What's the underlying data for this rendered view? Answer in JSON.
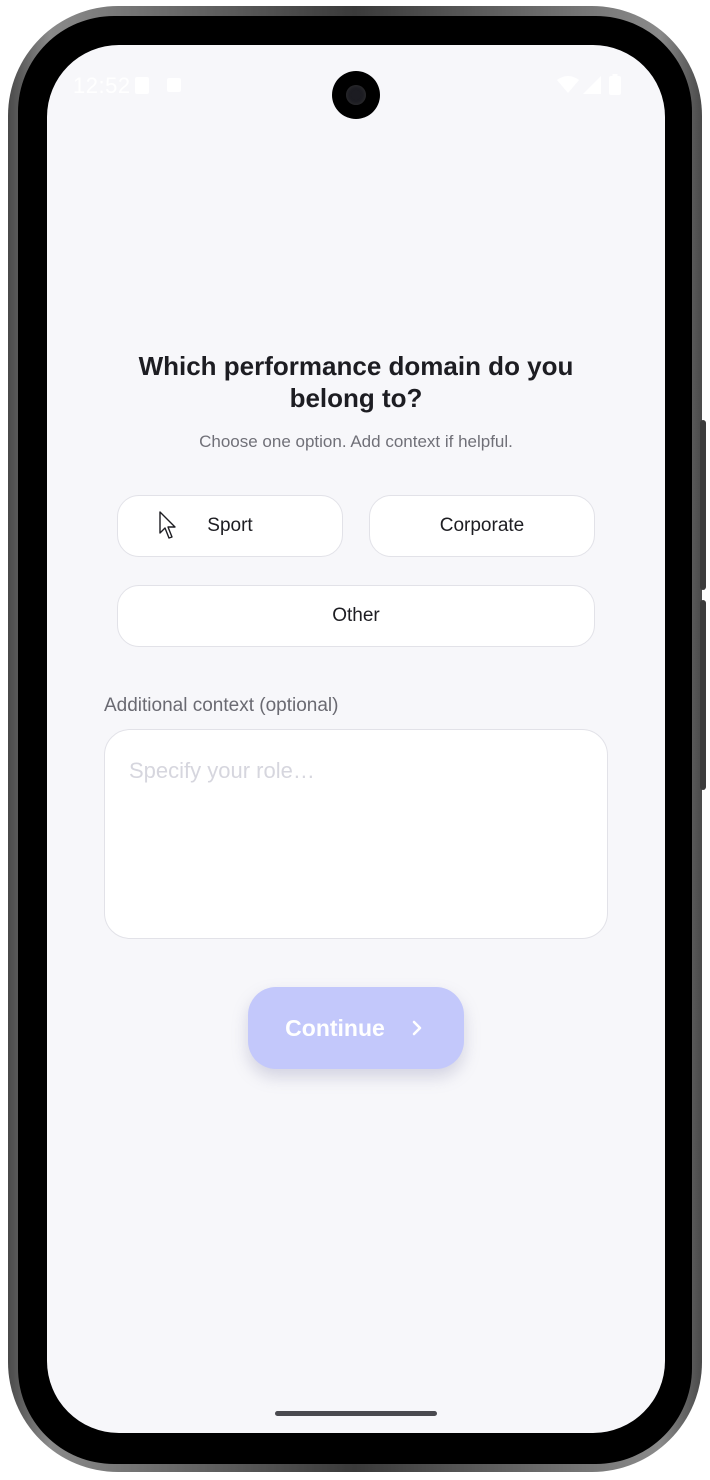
{
  "status_bar": {
    "time": "12:52"
  },
  "question": {
    "title": "Which performance domain do you belong to?",
    "subtitle": "Choose one option. Add context if helpful."
  },
  "options": [
    {
      "label": "Sport"
    },
    {
      "label": "Corporate"
    },
    {
      "label": "Other"
    }
  ],
  "context": {
    "label": "Additional context (optional)",
    "placeholder": "Specify your role…",
    "value": ""
  },
  "continue_button": {
    "label": "Continue",
    "icon": "chevron-right-icon"
  },
  "colors": {
    "accent_disabled": "#c3c8fb",
    "background": "#f7f7fa",
    "text_primary": "#1d1d22",
    "text_secondary": "#707078"
  }
}
